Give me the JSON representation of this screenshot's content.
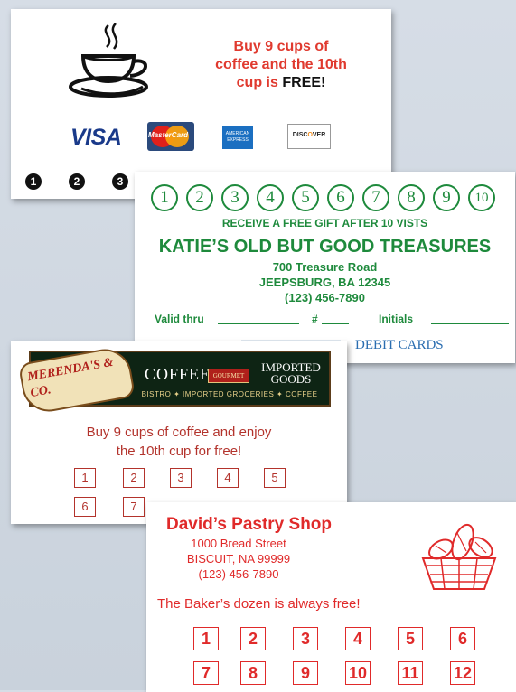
{
  "card1": {
    "promo_line1": "Buy 9 cups of",
    "promo_line2": "coffee and the 10th",
    "promo_line3a": "cup is ",
    "promo_line3b": "FREE!",
    "visa": "VISA",
    "mastercard": "MasterCard",
    "amex": "AMERICAN EXPRESS",
    "discover_a": "DISC",
    "discover_o": "O",
    "discover_b": "VER",
    "stamps": [
      "1",
      "2",
      "3"
    ]
  },
  "card2": {
    "numbers": [
      "1",
      "2",
      "3",
      "4",
      "5",
      "6",
      "7",
      "8",
      "9",
      "10"
    ],
    "gift": "RECEIVE A FREE GIFT AFTER 10 VISTS",
    "title": "KATIE’S OLD BUT GOOD TREASURES",
    "address1": "700 Treasure Road",
    "address2": "JEEPSBURG, BA 12345",
    "phone": "(123) 456-7890",
    "valid": "Valid thru",
    "hash": "#",
    "initials": "Initials",
    "debit": "DEBIT CARDS"
  },
  "card3": {
    "logo_name": "MERENDA'S & CO.",
    "coffee": "COFFEE",
    "gourmet": "GOURMET",
    "imported": "IMPORTED GOODS",
    "bistro": "BISTRO ✦ IMPORTED GROCERIES ✦ COFFEE",
    "msg1": "Buy 9 cups of coffee and enjoy",
    "msg2": "the 10th cup for free!",
    "boxes": [
      "1",
      "2",
      "3",
      "4",
      "5",
      "6",
      "7"
    ]
  },
  "card4": {
    "name": "David’s Pastry Shop",
    "address1": "1000 Bread Street",
    "address2": "BISCUIT, NA 99999",
    "phone": "(123) 456-7890",
    "baker": "The Baker’s dozen is always free!",
    "boxes_row1": [
      "1",
      "2",
      "3",
      "4",
      "5",
      "6"
    ],
    "boxes_row2": [
      "7",
      "8",
      "9",
      "10",
      "11",
      "12"
    ]
  },
  "colors": {
    "red": "#e02a2a",
    "green": "#1e8a3c",
    "coffee_red": "#e03a2f"
  },
  "icons": [
    "coffee-cup-icon",
    "bread-basket-icon"
  ]
}
